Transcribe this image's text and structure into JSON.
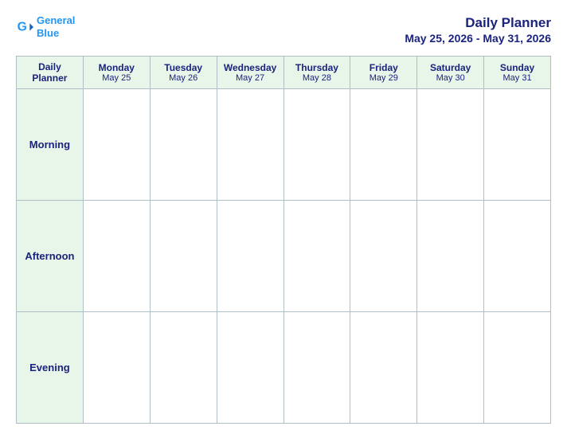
{
  "logo": {
    "general": "General",
    "blue": "Blue"
  },
  "header": {
    "title": "Daily Planner",
    "subtitle": "May 25, 2026 - May 31, 2026"
  },
  "columns": [
    {
      "id": "label",
      "name": "Daily Planner",
      "date": ""
    },
    {
      "id": "mon",
      "name": "Monday",
      "date": "May 25"
    },
    {
      "id": "tue",
      "name": "Tuesday",
      "date": "May 26"
    },
    {
      "id": "wed",
      "name": "Wednesday",
      "date": "May 27"
    },
    {
      "id": "thu",
      "name": "Thursday",
      "date": "May 28"
    },
    {
      "id": "fri",
      "name": "Friday",
      "date": "May 29"
    },
    {
      "id": "sat",
      "name": "Saturday",
      "date": "May 30"
    },
    {
      "id": "sun",
      "name": "Sunday",
      "date": "May 31"
    }
  ],
  "rows": [
    {
      "label": "Morning"
    },
    {
      "label": "Afternoon"
    },
    {
      "label": "Evening"
    }
  ]
}
